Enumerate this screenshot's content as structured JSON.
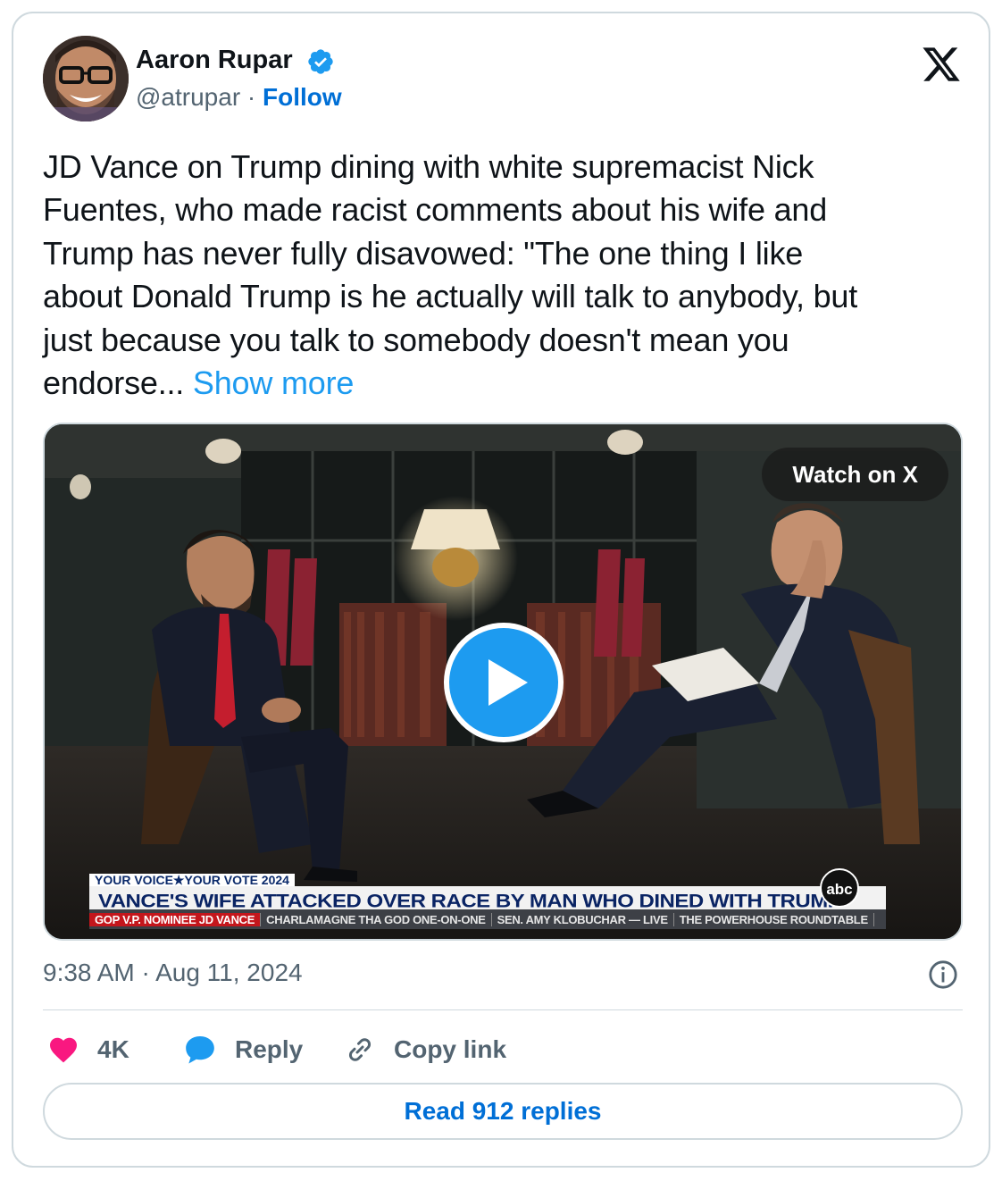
{
  "author": {
    "name": "Aaron Rupar",
    "handle": "@atrupar",
    "separator": "·",
    "follow_label": "Follow"
  },
  "tweet": {
    "lines": [
      "JD Vance on Trump dining with white supremacist Nick",
      "Fuentes, who made racist comments about his wife and",
      "Trump has never fully disavowed: \"The one thing I like",
      "about Donald Trump is he actually will talk to anybody, but",
      "just because you talk to somebody doesn't mean you",
      "endorse..."
    ],
    "show_more": "Show more"
  },
  "media": {
    "watch_label": "Watch on X",
    "lower_third": {
      "top_line": "YOUR VOICE★YOUR VOTE 2024",
      "headline": "VANCE'S WIFE ATTACKED OVER RACE BY MAN WHO DINED WITH TRUMP",
      "segments": [
        "GOP V.P. NOMINEE JD VANCE",
        "CHARLAMAGNE THA GOD ONE-ON-ONE",
        "SEN. AMY KLOBUCHAR — LIVE",
        "THE POWERHOUSE ROUNDTABLE"
      ],
      "network_logo": "abc"
    }
  },
  "meta": {
    "timestamp": "9:38 AM · Aug 11, 2024"
  },
  "actions": {
    "likes": "4K",
    "reply_label": "Reply",
    "copy_link_label": "Copy link"
  },
  "footer": {
    "read_replies": "Read 912 replies"
  },
  "colors": {
    "accent": "#1d9bf0",
    "link": "#006fd6",
    "like": "#f91880",
    "muted": "#536471",
    "border": "#cfd9de"
  },
  "icons": [
    "verified-badge-icon",
    "x-logo-icon",
    "play-icon",
    "info-icon",
    "heart-icon",
    "reply-bubble-icon",
    "link-icon"
  ]
}
